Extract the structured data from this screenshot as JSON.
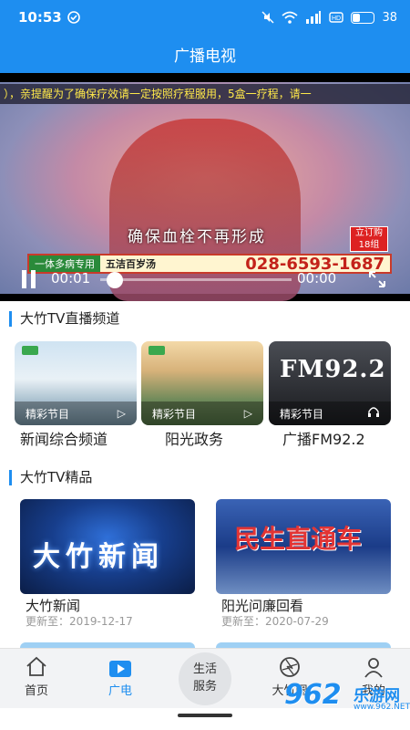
{
  "status_bar": {
    "time": "10:53",
    "battery": "38",
    "battery_level": 0.38
  },
  "header": {
    "title": "广播电视"
  },
  "player": {
    "ticker": "），亲提醒为了确保疗效请一定按照疗程服用，5盒一疗程，请一",
    "caption": "确保血栓不再形成",
    "promo_left": "一体多病专用",
    "promo_product": "五洁百岁汤",
    "promo_phone": "028-6593-1687",
    "order_badge_line1": "立订购",
    "order_badge_line2": "18组",
    "current_time": "00:01",
    "total_time": "00:00"
  },
  "live_section": {
    "title": "大竹TV直播频道",
    "channels": [
      {
        "tag": "精彩节目",
        "name": "新闻综合频道",
        "icon": "play-icon"
      },
      {
        "tag": "精彩节目",
        "name": "阳光政务",
        "icon": "play-icon"
      },
      {
        "tag": "精彩节目",
        "name": "广播FM92.2",
        "icon": "headphones-icon",
        "thumb_text": "FM92.2"
      }
    ]
  },
  "premium_section": {
    "title": "大竹TV精品",
    "items": [
      {
        "thumb_text": "大竹新闻",
        "name": "大竹新闻",
        "update": "更新至：2019-12-17"
      },
      {
        "thumb_text": "民生直通车",
        "name": "阳光问廉回看",
        "update": "更新至：2020-07-29"
      }
    ]
  },
  "bottom_nav": {
    "home": "首页",
    "broadcast": "广电",
    "center_line1": "生活",
    "center_line2": "服务",
    "dazhu": "大竹圈",
    "mine": "我的"
  },
  "watermark": {
    "number": "962",
    "text": "乐游网",
    "url": "www.962.NET"
  },
  "colors": {
    "primary": "#1e8ef0",
    "nav_bg": "#f2f3f5"
  }
}
